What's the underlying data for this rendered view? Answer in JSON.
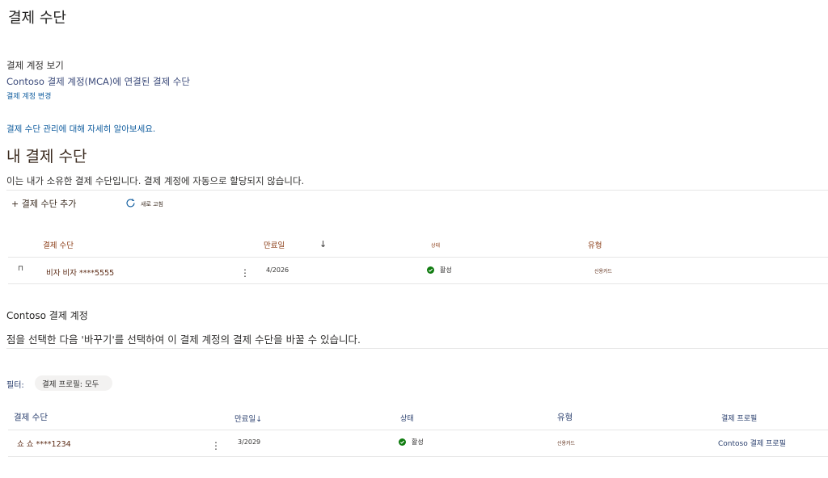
{
  "page": {
    "title": "결제 수단"
  },
  "billing_account": {
    "view_label": "결제 계정 보기",
    "account_name": "Contoso 결제 계정(MCA)에 연결된 결제 수단",
    "change_link": "결제 계정 변경"
  },
  "learn_more": "결제 수단 관리에 대해 자세히 알아보세요.",
  "my_methods": {
    "heading": "내 결제 수단",
    "description": "이는 내가 소유한 결제 수단입니다. 결제 계정에 자동으로 할당되지 않습니다.",
    "add_label": "+ 결제 수단 추가",
    "refresh_label": "새로 고침",
    "columns": {
      "method": "결제 수단",
      "expiry": "만료일",
      "sort_arrow": "↓",
      "status": "상태",
      "type": "유형"
    },
    "rows": [
      {
        "icon_glyph": "⊓",
        "method": "비자 비자 ****5555",
        "more": "⋮",
        "expiry": "4/2026",
        "status": "활성",
        "type": "신용카드"
      }
    ]
  },
  "contoso_account": {
    "title": "Contoso 결제 계정",
    "description": "점을 선택한 다음 '바꾸기'를 선택하여 이 결제 계정의 결제 수단을 바꿀 수 있습니다.",
    "filter_label": "필터:",
    "filter_pill": "결제 프로필: 모두",
    "columns": {
      "method": "결제 수단",
      "expiry": "만료일↓",
      "status": "상태",
      "type": "유형",
      "profile": "결제 프로필"
    },
    "rows": [
      {
        "method": "쇼 쇼 ****1234",
        "more": "⋮",
        "expiry": "3/2029",
        "status": "활성",
        "type": "신용카드",
        "profile": "Contoso 결제 프로필"
      }
    ]
  },
  "colors": {
    "link": "#0f5c9e",
    "status_active": "#107c10",
    "header_brown": "#8a3b14"
  },
  "icons": {
    "refresh": "refresh-icon",
    "status": "check-circle-icon",
    "card": "card-icon",
    "more": "more-vertical-icon"
  }
}
